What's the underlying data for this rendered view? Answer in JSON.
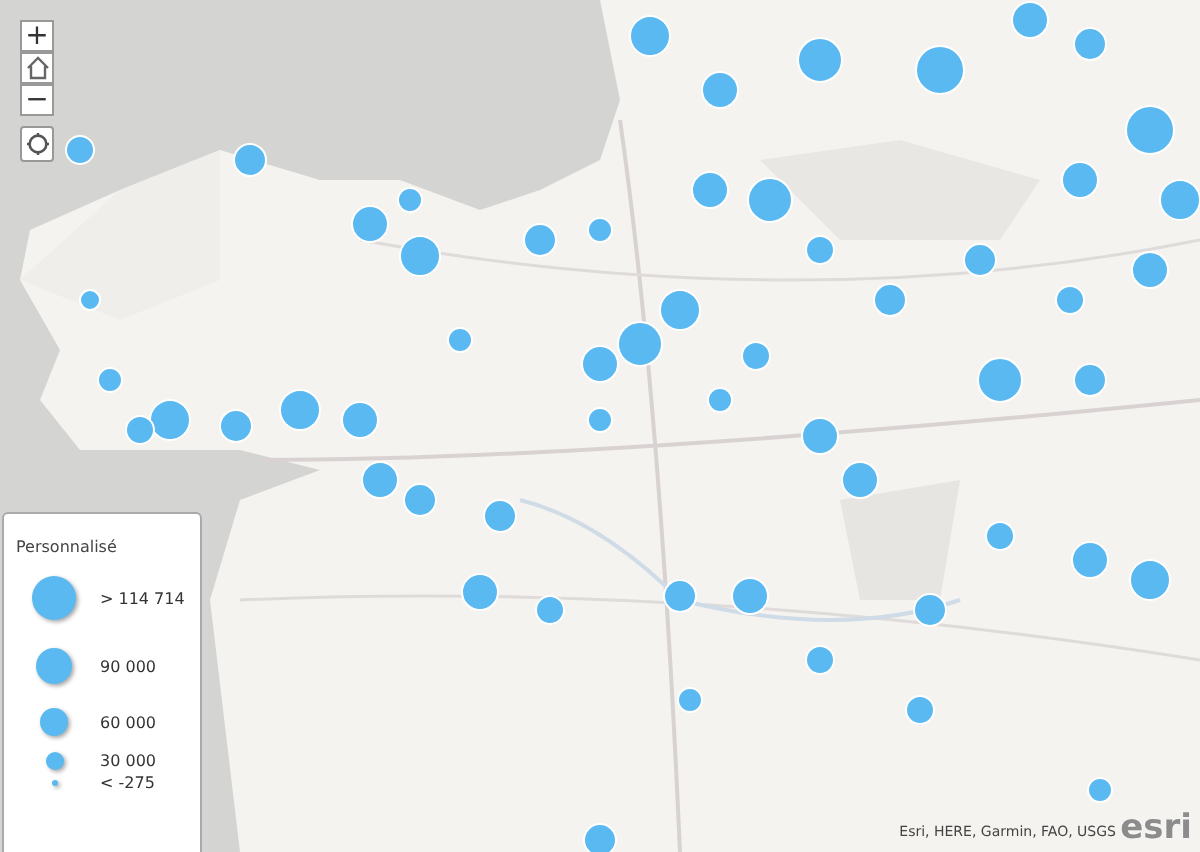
{
  "controls": [
    {
      "kind": "zoom-in",
      "label": "+"
    },
    {
      "kind": "home"
    },
    {
      "kind": "zoom-out",
      "label": "−"
    },
    {
      "kind": "locate"
    }
  ],
  "legend": {
    "title": "Personnalisé",
    "items": [
      {
        "label": "> 114 714"
      },
      {
        "label": "90 000"
      },
      {
        "label": "60 000"
      },
      {
        "label": "30 000"
      },
      {
        "label": "< -275"
      }
    ]
  },
  "attribution": "Esri, HERE, Garmin, FAO, USGS",
  "logo": "esri"
}
